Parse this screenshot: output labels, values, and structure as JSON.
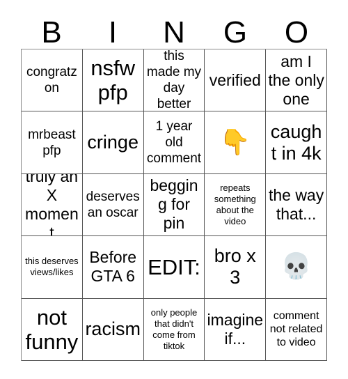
{
  "card": {
    "type": "bingo-card",
    "columns": 5,
    "rows": 5,
    "background_color": "#ffffff",
    "text_color": "#000000",
    "border_color": "#555555"
  },
  "header": {
    "letters": [
      "B",
      "I",
      "N",
      "G",
      "O"
    ]
  },
  "grid": {
    "cells": [
      {
        "text": "congratz on",
        "size": "md",
        "kind": "text"
      },
      {
        "text": "nsfw pfp",
        "size": "xxl",
        "kind": "text"
      },
      {
        "text": "this made my day better",
        "size": "md",
        "kind": "text"
      },
      {
        "text": "verified",
        "size": "lg",
        "kind": "text"
      },
      {
        "text": "am I the only one",
        "size": "lg",
        "kind": "text"
      },
      {
        "text": "mrbeast pfp",
        "size": "md",
        "kind": "text"
      },
      {
        "text": "cringe",
        "size": "xl",
        "kind": "text"
      },
      {
        "text": "1 year old comment",
        "size": "md",
        "kind": "text"
      },
      {
        "text": "👇",
        "size": "md",
        "kind": "emoji",
        "emoji_name": "backhand-index-pointing-down"
      },
      {
        "text": "caught in 4k",
        "size": "xl",
        "kind": "text"
      },
      {
        "text": "truly an X moment",
        "size": "lg",
        "kind": "text"
      },
      {
        "text": "deserves an oscar",
        "size": "md",
        "kind": "text"
      },
      {
        "text": "begging for pin",
        "size": "lg",
        "kind": "text"
      },
      {
        "text": "repeats something about the video",
        "size": "xs",
        "kind": "text"
      },
      {
        "text": "the way that...",
        "size": "lg",
        "kind": "text"
      },
      {
        "text": "this deserves views/likes",
        "size": "xs",
        "kind": "text"
      },
      {
        "text": "Before GTA 6",
        "size": "lg",
        "kind": "text"
      },
      {
        "text": "EDIT:",
        "size": "xxl",
        "kind": "text"
      },
      {
        "text": "bro x 3",
        "size": "xl",
        "kind": "text"
      },
      {
        "text": "💀",
        "size": "md",
        "kind": "emoji",
        "emoji_name": "skull"
      },
      {
        "text": "not funny",
        "size": "xxl",
        "kind": "text"
      },
      {
        "text": "racism",
        "size": "xl",
        "kind": "text"
      },
      {
        "text": "only people that didn't come from tiktok",
        "size": "xs",
        "kind": "text"
      },
      {
        "text": "imagine if...",
        "size": "lg",
        "kind": "text"
      },
      {
        "text": "comment not related to video",
        "size": "sm",
        "kind": "text"
      }
    ]
  }
}
